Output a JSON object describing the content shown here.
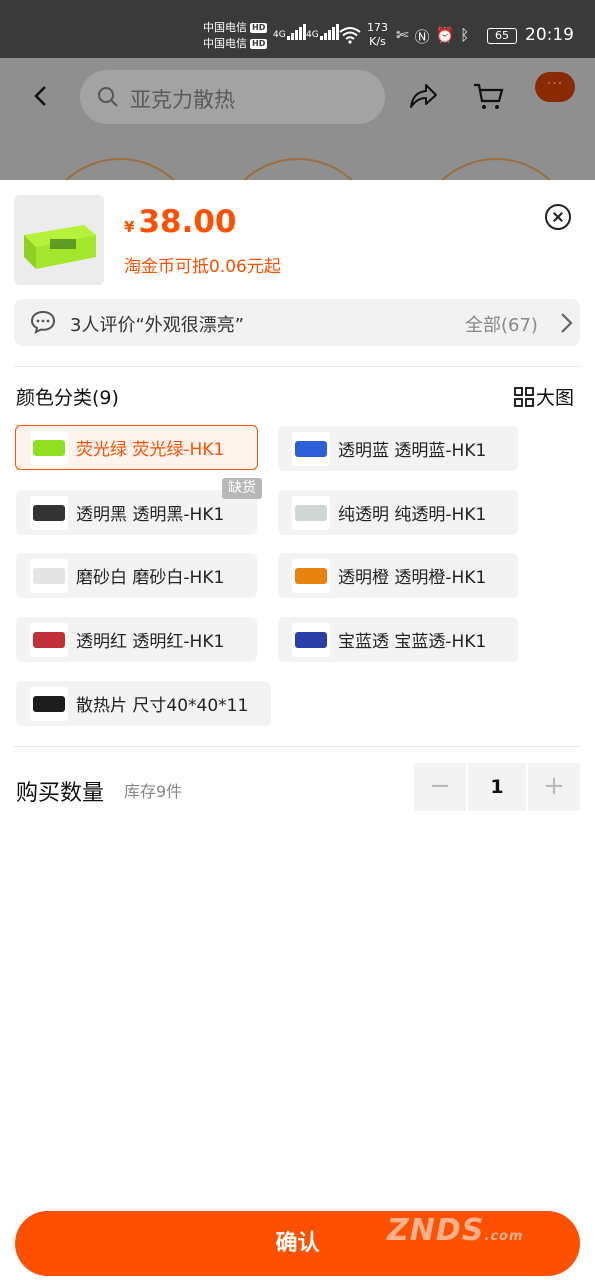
{
  "status_bar": {
    "carrier1": "中国电信",
    "carrier2": "中国电信",
    "hd": "HD",
    "net1": "4G",
    "net2": "4G",
    "speed_value": "173",
    "speed_unit": "K/s",
    "battery": "65",
    "time": "20:19"
  },
  "background_page": {
    "search_text": "亚克力散热",
    "more_label": "···"
  },
  "product": {
    "currency": "¥",
    "price": "38.00",
    "coin_note": "淘金币可抵0.06元起"
  },
  "review": {
    "text": "3人评价“外观很漂亮”",
    "all_label": "全部(67)"
  },
  "color_section": {
    "title": "颜色分类(9)",
    "big_pic_label": "大图",
    "sold_out_badge": "缺货",
    "options": [
      {
        "label": "荧光绿 荧光绿-HK1",
        "selected": true,
        "color": "#8fe020"
      },
      {
        "label": "透明蓝 透明蓝-HK1",
        "selected": false,
        "color": "#2f5fd8"
      },
      {
        "label": "透明黑 透明黑-HK1",
        "selected": false,
        "color": "#333333"
      },
      {
        "label": "纯透明 纯透明-HK1",
        "selected": false,
        "color": "#cfd6d4"
      },
      {
        "label": "磨砂白 磨砂白-HK1",
        "selected": false,
        "color": "#e4e4e4"
      },
      {
        "label": "透明橙 透明橙-HK1",
        "selected": false,
        "color": "#e8820f"
      },
      {
        "label": "透明红 透明红-HK1",
        "selected": false,
        "color": "#c2303a"
      },
      {
        "label": "宝蓝透 宝蓝透-HK1",
        "selected": false,
        "color": "#2c3da8"
      },
      {
        "label": "散热片 尺寸40*40*11",
        "selected": false,
        "color": "#1c1c1c"
      }
    ]
  },
  "quantity": {
    "title": "购买数量",
    "stock": "库存9件",
    "minus": "−",
    "value": "1",
    "plus": "+"
  },
  "confirm_label": "确认",
  "watermark": "ZNDS",
  "watermark_suffix": ".com",
  "colors": {
    "accent": "#ff5000",
    "status_bar": "#3a3a3a",
    "dim_overlay": "#8f8f8f"
  }
}
